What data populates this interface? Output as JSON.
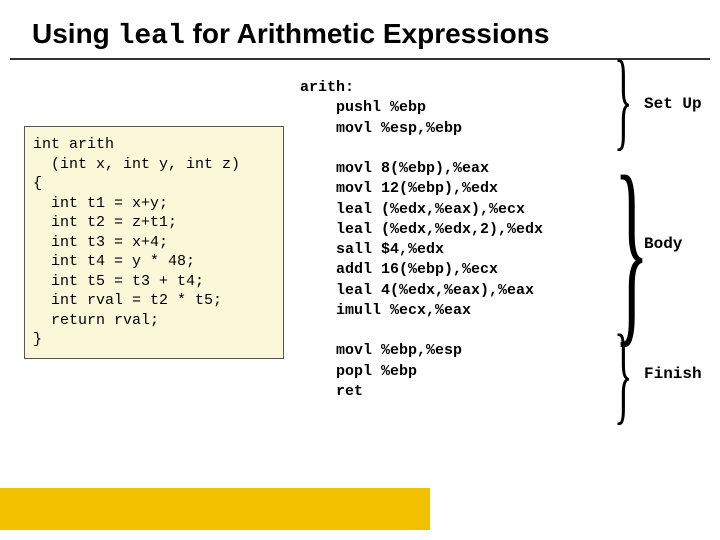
{
  "title_prefix": "Using ",
  "title_mono": "leal",
  "title_suffix": " for Arithmetic Expressions",
  "c_code": "int arith\n  (int x, int y, int z)\n{\n  int t1 = x+y;\n  int t2 = z+t1;\n  int t3 = x+4;\n  int t4 = y * 48;\n  int t5 = t3 + t4;\n  int rval = t2 * t5;\n  return rval;\n}",
  "asm_code": "arith:\n    pushl %ebp\n    movl %esp,%ebp\n\n    movl 8(%ebp),%eax\n    movl 12(%ebp),%edx\n    leal (%edx,%eax),%ecx\n    leal (%edx,%edx,2),%edx\n    sall $4,%edx\n    addl 16(%ebp),%ecx\n    leal 4(%edx,%eax),%eax\n    imull %ecx,%eax\n\n    movl %ebp,%esp\n    popl %ebp\n    ret",
  "labels": {
    "setup": "Set\nUp",
    "body": "Body",
    "finish": "Finish"
  }
}
